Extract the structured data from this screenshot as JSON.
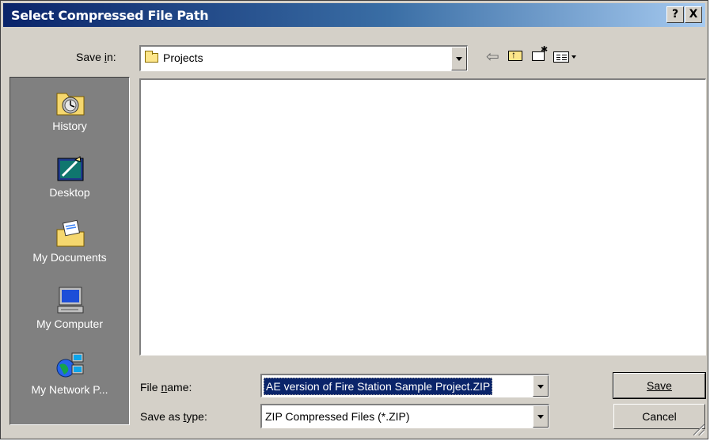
{
  "window": {
    "title": "Select Compressed File Path",
    "help_label": "?",
    "close_label": "X"
  },
  "save_in": {
    "label": "Save in:",
    "value": "Projects",
    "icon": "folder-icon"
  },
  "toolbar": {
    "icons": [
      "back-icon",
      "up-one-level-icon",
      "new-folder-icon",
      "view-menu-icon"
    ]
  },
  "places": [
    {
      "label": "History",
      "icon": "history-icon"
    },
    {
      "label": "Desktop",
      "icon": "desktop-icon"
    },
    {
      "label": "My Documents",
      "icon": "my-documents-icon"
    },
    {
      "label": "My Computer",
      "icon": "my-computer-icon"
    },
    {
      "label": "My Network P...",
      "icon": "my-network-places-icon"
    }
  ],
  "file_name": {
    "label": "File name:",
    "value": "AE version of Fire Station Sample Project.ZIP"
  },
  "save_as_type": {
    "label": "Save as type:",
    "value": "ZIP Compressed Files (*.ZIP)"
  },
  "buttons": {
    "save": "Save",
    "cancel": "Cancel"
  },
  "colors": {
    "title_start": "#0a246a",
    "title_end": "#a6caf0",
    "face": "#d4d0c8",
    "places_bg": "#808080",
    "selection": "#0a246a"
  }
}
